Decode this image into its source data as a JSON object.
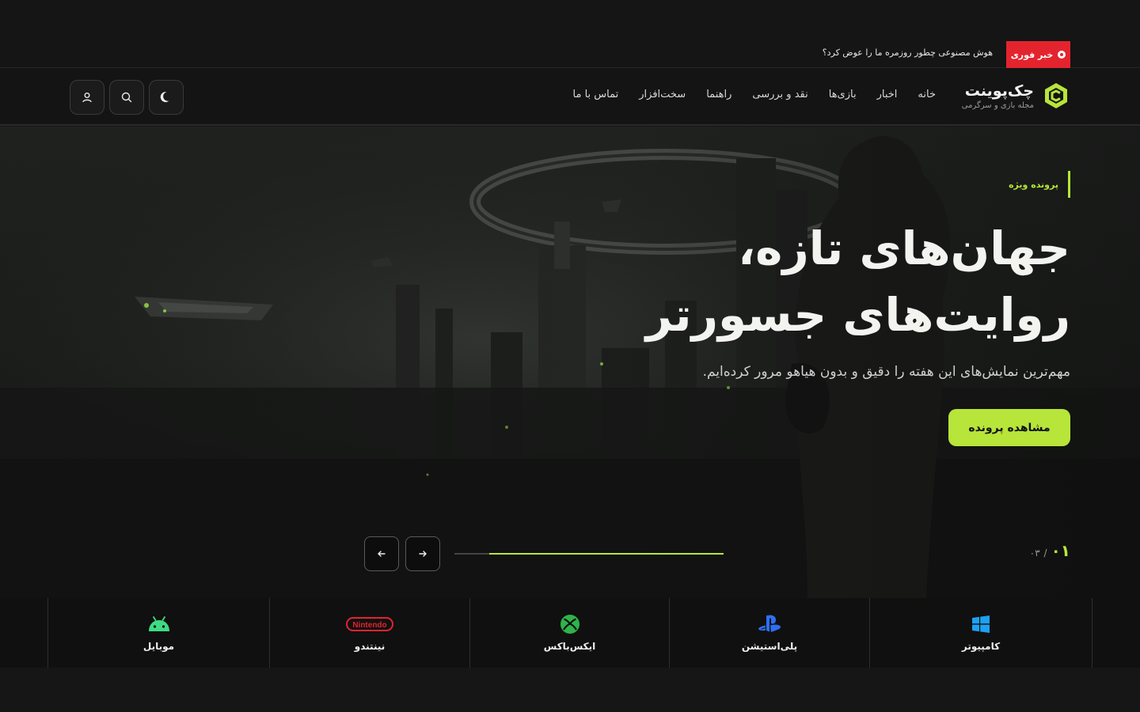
{
  "breaking": {
    "badge": "خبر فوری",
    "headline": "هوش مصنوعی چطور روزمره ما را عوض کرد؟"
  },
  "brand": {
    "name": "چک‌پوینت",
    "tagline": "مجله بازی و سرگرمی",
    "accent": "#b7e53a"
  },
  "nav": {
    "items": [
      {
        "label": "خانه"
      },
      {
        "label": "اخبار"
      },
      {
        "label": "بازی‌ها"
      },
      {
        "label": "نقد و بررسی"
      },
      {
        "label": "راهنما"
      },
      {
        "label": "سخت‌افزار"
      },
      {
        "label": "تماس با ما"
      }
    ]
  },
  "header_actions": {
    "theme_icon": "moon-icon",
    "search_icon": "search-icon",
    "user_icon": "user-icon"
  },
  "hero": {
    "tag": "پرونده ویژه",
    "title_line1": "جهان‌های تازه،",
    "title_line2": "روایت‌های جسورتر",
    "description": "مهم‌ترین نمایش‌های این هفته را دقیق و بدون هیاهو مرور کرده‌ایم.",
    "cta": "مشاهده پرونده",
    "slide_current": "۰۱",
    "slide_separator": "/",
    "slide_total": "۰۳",
    "progress": 0.87
  },
  "platforms": [
    {
      "label": "کامپیوتر",
      "icon": "windows-icon",
      "color": "#1ea1f2"
    },
    {
      "label": "پلی‌استیشن",
      "icon": "playstation-icon",
      "color": "#2e6ff2"
    },
    {
      "label": "ایکس‌باکس",
      "icon": "xbox-icon",
      "color": "#2fb34a"
    },
    {
      "label": "نینتندو",
      "icon": "nintendo-icon",
      "color": "#e3242f",
      "logo_text": "Nintendo"
    },
    {
      "label": "موبایل",
      "icon": "android-icon",
      "color": "#3ddc84"
    }
  ]
}
